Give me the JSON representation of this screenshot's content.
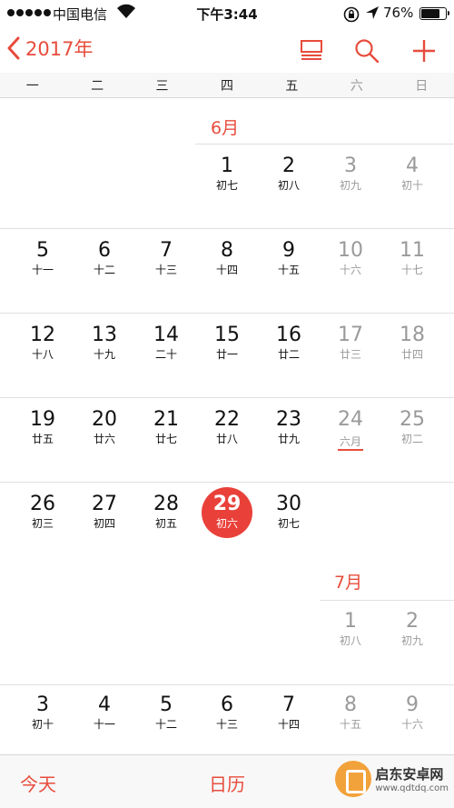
{
  "status_bar": {
    "carrier": "中国电信",
    "time": "下午3:44",
    "battery_percent": "76%",
    "battery_level": 0.76
  },
  "nav": {
    "back_label": "2017年",
    "accent_color": "#e74c3c"
  },
  "weekdays": [
    "一",
    "二",
    "三",
    "四",
    "五",
    "六",
    "日"
  ],
  "months": {
    "june": "6月",
    "july": "7月"
  },
  "weeks": [
    [
      null,
      null,
      null,
      {
        "n": "1",
        "l": "初七"
      },
      {
        "n": "2",
        "l": "初八"
      },
      {
        "n": "3",
        "l": "初九"
      },
      {
        "n": "4",
        "l": "初十"
      }
    ],
    [
      {
        "n": "5",
        "l": "十一"
      },
      {
        "n": "6",
        "l": "十二"
      },
      {
        "n": "7",
        "l": "十三"
      },
      {
        "n": "8",
        "l": "十四"
      },
      {
        "n": "9",
        "l": "十五"
      },
      {
        "n": "10",
        "l": "十六"
      },
      {
        "n": "11",
        "l": "十七"
      }
    ],
    [
      {
        "n": "12",
        "l": "十八"
      },
      {
        "n": "13",
        "l": "十九"
      },
      {
        "n": "14",
        "l": "二十"
      },
      {
        "n": "15",
        "l": "廿一"
      },
      {
        "n": "16",
        "l": "廿二"
      },
      {
        "n": "17",
        "l": "廿三"
      },
      {
        "n": "18",
        "l": "廿四"
      }
    ],
    [
      {
        "n": "19",
        "l": "廿五"
      },
      {
        "n": "20",
        "l": "廿六"
      },
      {
        "n": "21",
        "l": "廿七"
      },
      {
        "n": "22",
        "l": "廿八"
      },
      {
        "n": "23",
        "l": "廿九"
      },
      {
        "n": "24",
        "l": "六月",
        "holiday": true
      },
      {
        "n": "25",
        "l": "初二"
      }
    ],
    [
      {
        "n": "26",
        "l": "初三"
      },
      {
        "n": "27",
        "l": "初四"
      },
      {
        "n": "28",
        "l": "初五"
      },
      {
        "n": "29",
        "l": "初六",
        "today": true
      },
      {
        "n": "30",
        "l": "初七"
      },
      {
        "n": "1",
        "l": "初八"
      },
      {
        "n": "2",
        "l": "初九"
      }
    ],
    [
      {
        "n": "3",
        "l": "初十"
      },
      {
        "n": "4",
        "l": "十一"
      },
      {
        "n": "5",
        "l": "十二"
      },
      {
        "n": "6",
        "l": "十三"
      },
      {
        "n": "7",
        "l": "十四"
      },
      {
        "n": "8",
        "l": "十五"
      },
      {
        "n": "9",
        "l": "十六"
      }
    ]
  ],
  "tab_bar": {
    "today_label": "今天",
    "calendar_label": "日历"
  },
  "watermark": {
    "title": "启东安卓网",
    "url": "www.qdtdq.com"
  }
}
